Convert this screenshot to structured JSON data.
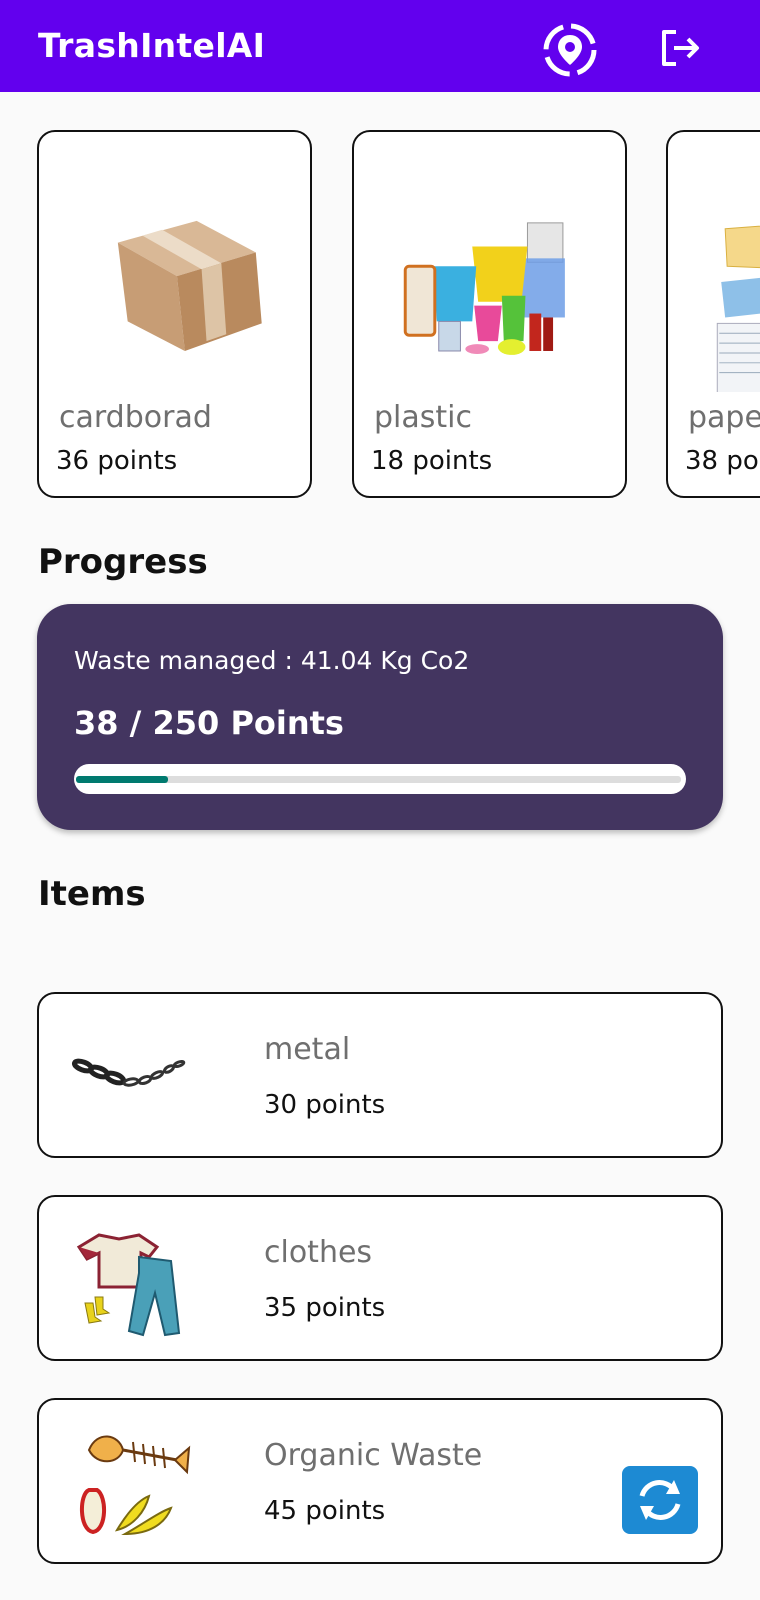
{
  "app": {
    "title": "TrashIntelAI"
  },
  "header_icons": {
    "location": "location-pin-icon",
    "logout": "logout-icon"
  },
  "categories": [
    {
      "name": "cardborad",
      "points": "36 points",
      "image": "cardboard-box"
    },
    {
      "name": "plastic",
      "points": "18 points",
      "image": "plastic-containers"
    },
    {
      "name": "pape",
      "points": "38 poi",
      "image": "paper-sheets"
    }
  ],
  "progress": {
    "section_title": "Progress",
    "waste_managed": "Waste managed : 41.04 Kg Co2",
    "points_label": "38 / 250 Points",
    "fraction": 0.152
  },
  "items": {
    "section_title": "Items",
    "list": [
      {
        "name": "metal",
        "points": "30 points",
        "image": "metal-chain"
      },
      {
        "name": "clothes",
        "points": "35 points",
        "image": "clothes"
      },
      {
        "name": "Organic Waste",
        "points": "45 points",
        "image": "organic-waste"
      }
    ]
  },
  "colors": {
    "appbar": "#6200ee",
    "progress_card": "#433560",
    "progress_fill": "#007a6f",
    "camera_button": "#1d8ad3"
  }
}
